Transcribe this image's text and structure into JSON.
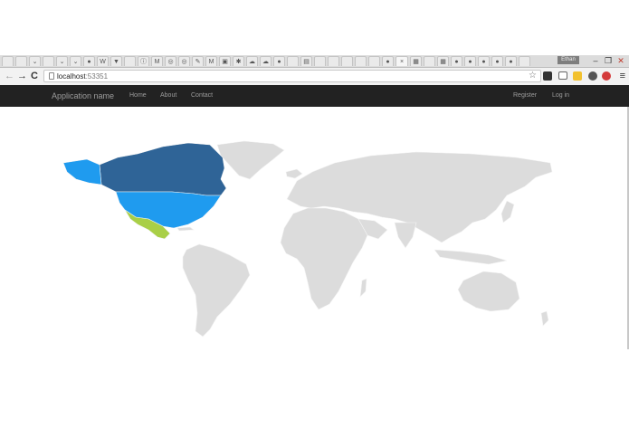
{
  "browser": {
    "tabs": [
      {
        "icon": "page-icon",
        "glyph": ""
      },
      {
        "icon": "page-icon",
        "glyph": ""
      },
      {
        "icon": "chevron-icon",
        "glyph": "⌄"
      },
      {
        "icon": "page-icon",
        "glyph": ""
      },
      {
        "icon": "chevron-icon",
        "glyph": "⌄"
      },
      {
        "icon": "chevron-icon",
        "glyph": "⌄"
      },
      {
        "icon": "github-icon",
        "glyph": "●"
      },
      {
        "icon": "wikipedia-icon",
        "glyph": "W"
      },
      {
        "icon": "shield-icon",
        "glyph": "▼"
      },
      {
        "icon": "page-icon",
        "glyph": ""
      },
      {
        "icon": "info-icon",
        "glyph": "ⓘ"
      },
      {
        "icon": "gmail-icon",
        "glyph": "M"
      },
      {
        "icon": "globe-icon",
        "glyph": "◎"
      },
      {
        "icon": "globe-icon",
        "glyph": "◎"
      },
      {
        "icon": "tool-icon",
        "glyph": "✎"
      },
      {
        "icon": "medium-icon",
        "glyph": "M"
      },
      {
        "icon": "image-icon",
        "glyph": "▣"
      },
      {
        "icon": "bug-icon",
        "glyph": "✱"
      },
      {
        "icon": "cloud-icon",
        "glyph": "☁"
      },
      {
        "icon": "cloud-icon",
        "glyph": "☁"
      },
      {
        "icon": "github-icon",
        "glyph": "●"
      },
      {
        "icon": "page-icon",
        "glyph": ""
      },
      {
        "icon": "document-icon",
        "glyph": "▤"
      },
      {
        "icon": "page-icon",
        "glyph": ""
      },
      {
        "icon": "page-icon",
        "glyph": ""
      },
      {
        "icon": "page-icon",
        "glyph": ""
      },
      {
        "icon": "page-icon",
        "glyph": ""
      },
      {
        "icon": "page-icon",
        "glyph": ""
      },
      {
        "icon": "github-icon",
        "glyph": "●"
      },
      {
        "icon": "close-icon",
        "glyph": "×"
      },
      {
        "icon": "windows-icon",
        "glyph": "▦"
      },
      {
        "icon": "page-icon",
        "glyph": ""
      },
      {
        "icon": "grid-icon",
        "glyph": "▦"
      },
      {
        "icon": "github-icon",
        "glyph": "●"
      },
      {
        "icon": "github-icon",
        "glyph": "●"
      },
      {
        "icon": "github-icon",
        "glyph": "●"
      },
      {
        "icon": "github-icon",
        "glyph": "●"
      },
      {
        "icon": "github-icon",
        "glyph": "●"
      },
      {
        "icon": "page-icon",
        "glyph": ""
      }
    ],
    "user_badge": "Ethan",
    "window_controls": {
      "minimize": "–",
      "restore": "❐",
      "close": "✕"
    },
    "nav": {
      "back": "←",
      "forward": "→",
      "reload": "C"
    },
    "url_host": "localhost",
    "url_port": ":53351",
    "star": "☆",
    "menu": "≡"
  },
  "navbar": {
    "brand": "Application name",
    "links": {
      "home": "Home",
      "about": "About",
      "contact": "Contact"
    },
    "register": "Register",
    "login": "Log in"
  },
  "map": {
    "colors": {
      "default": "#dcdcdc",
      "canada": "#2f6497",
      "usa": "#1f9bef",
      "mexico": "#a9cf47",
      "border": "#f4f4f4"
    }
  }
}
